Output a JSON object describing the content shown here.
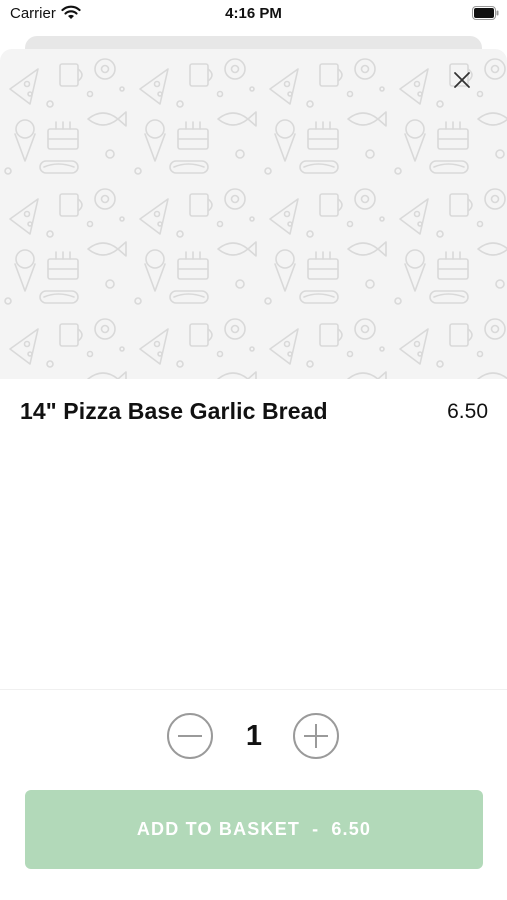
{
  "status_bar": {
    "carrier": "Carrier",
    "time": "4:16 PM"
  },
  "item": {
    "title": "14\" Pizza Base Garlic Bread",
    "price": "6.50"
  },
  "quantity": "1",
  "add_to_basket": {
    "label": "ADD TO BASKET",
    "separator": "-",
    "price": "6.50"
  },
  "colors": {
    "button_bg": "#b2d9b9",
    "hero_bg": "#f4f4f4"
  },
  "icons": [
    "wifi-icon",
    "battery-icon",
    "close-icon",
    "minus-icon",
    "plus-icon"
  ]
}
